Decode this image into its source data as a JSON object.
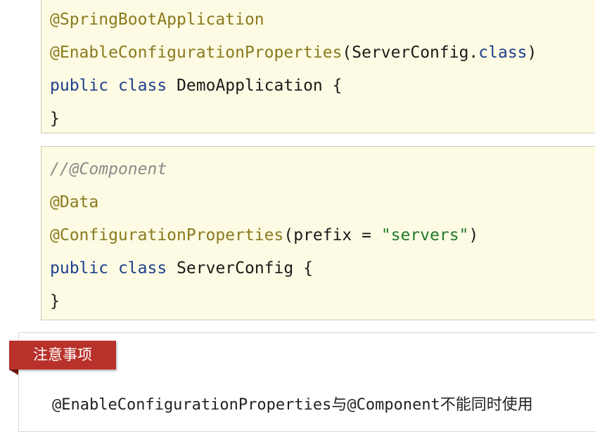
{
  "block1": {
    "line1": "@SpringBootApplication",
    "line2_annotation": "@EnableConfigurationProperties",
    "line2_open": "(ServerConfig.",
    "line2_kw": "class",
    "line2_close": ")",
    "line3_kw1": "public",
    "line3_kw2": "class",
    "line3_name": "DemoApplication {",
    "line4": "}"
  },
  "block2": {
    "line1": "//@Component",
    "line2": "@Data",
    "line3_annotation": "@ConfigurationProperties",
    "line3_open": "(prefix = ",
    "line3_str": "\"servers\"",
    "line3_close": ")",
    "line4_kw1": "public",
    "line4_kw2": "class",
    "line4_name": "ServerConfig {",
    "line5": "}"
  },
  "notice": {
    "tag": "注意事项",
    "text": "@EnableConfigurationProperties与@Component不能同时使用"
  },
  "colors": {
    "annotation": "#8a7a1e",
    "keyword": "#1f3f8f",
    "string": "#1f7a2a",
    "comment": "#8a8a8a",
    "code_bg": "#fdfbe3",
    "tag_bg": "#b8312a"
  }
}
